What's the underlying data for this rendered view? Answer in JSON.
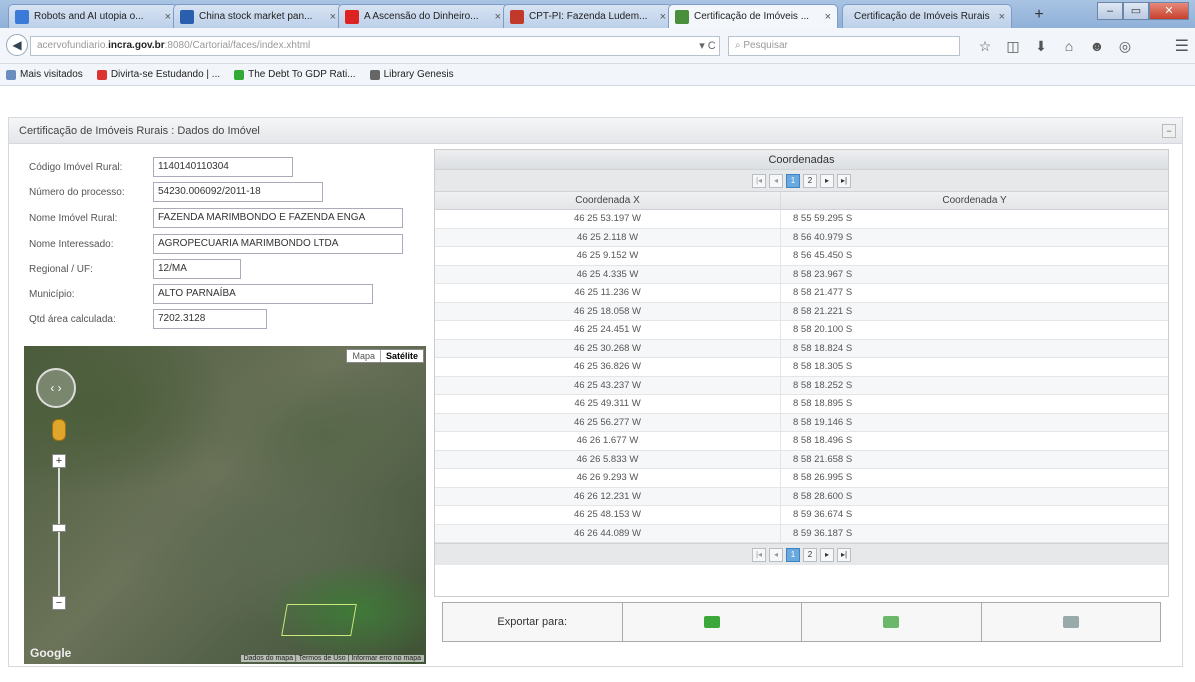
{
  "browser": {
    "tabs": [
      {
        "label": "Robots and AI utopia o...",
        "close": "×",
        "icon_color": "#3b7bd8"
      },
      {
        "label": "China stock market pan...",
        "close": "×",
        "icon_color": "#2a5fb0"
      },
      {
        "label": "A Ascensão do Dinheiro...",
        "close": "×",
        "icon_color": "#d22"
      },
      {
        "label": "CPT-PI: Fazenda Ludem...",
        "close": "×",
        "icon_color": "#c0392b"
      },
      {
        "label": "Certificação de Imóveis ...",
        "close": "×",
        "icon_color": "#4a8f3c"
      },
      {
        "label": "Certificação de Imóveis Rurais",
        "close": "×",
        "icon_color": ""
      }
    ],
    "new_tab": "+",
    "url_prefix": "acervofundiario.",
    "url_domain": "incra.gov.br",
    "url_suffix": ":8080/Cartorial/faces/index.xhtml",
    "reload": "▾ C",
    "search_placeholder": "Pesquisar",
    "tools": [
      "☆",
      "◫",
      "⬇",
      "⌂",
      "☻",
      "◎"
    ],
    "menu_icon": "☰",
    "bookmarks": [
      {
        "label": "Mais visitados",
        "color": "#6a8fbf"
      },
      {
        "label": "Divirta-se Estudando | ...",
        "color": "#d33"
      },
      {
        "label": "The Debt To GDP Rati...",
        "color": "#3a3"
      },
      {
        "label": "Library Genesis",
        "color": "#666"
      }
    ]
  },
  "panel": {
    "title": "Certificação de Imóveis Rurais : Dados do Imóvel",
    "collapse": "−"
  },
  "fields": [
    {
      "label": "Código Imóvel Rural:",
      "value": "1140140110304"
    },
    {
      "label": "Número do processo:",
      "value": "54230.006092/2011-18"
    },
    {
      "label": "Nome Imóvel Rural:",
      "value": "FAZENDA MARIMBONDO E FAZENDA ENGA"
    },
    {
      "label": "Nome Interessado:",
      "value": "AGROPECUARIA MARIMBONDO LTDA"
    },
    {
      "label": "Regional / UF:",
      "value": "12/MA"
    },
    {
      "label": "Município:",
      "value": "ALTO PARNAÍBA"
    },
    {
      "label": "Qtd área calculada:",
      "value": "7202.3128"
    }
  ],
  "map": {
    "types": [
      "Mapa",
      "Satélite"
    ],
    "zoom_in": "+",
    "zoom_out": "−",
    "logo": "Google",
    "attribution": "Dados do mapa | Termos de Uso | Informar erro no mapa"
  },
  "coords": {
    "title": "Coordenadas",
    "pager": {
      "first": "|◂",
      "prev": "◂",
      "page1": "1",
      "page2": "2",
      "next": "▸",
      "last": "▸|"
    },
    "header_x": "Coordenada X",
    "header_y": "Coordenada Y",
    "rows": [
      [
        "46 25 53.197 W",
        "8 55 59.295 S"
      ],
      [
        "46 25 2.118 W",
        "8 56 40.979 S"
      ],
      [
        "46 25 9.152 W",
        "8 56 45.450 S"
      ],
      [
        "46 25 4.335 W",
        "8 58 23.967 S"
      ],
      [
        "46 25 11.236 W",
        "8 58 21.477 S"
      ],
      [
        "46 25 18.058 W",
        "8 58 21.221 S"
      ],
      [
        "46 25 24.451 W",
        "8 58 20.100 S"
      ],
      [
        "46 25 30.268 W",
        "8 58 18.824 S"
      ],
      [
        "46 25 36.826 W",
        "8 58 18.305 S"
      ],
      [
        "46 25 43.237 W",
        "8 58 18.252 S"
      ],
      [
        "46 25 49.311 W",
        "8 58 18.895 S"
      ],
      [
        "46 25 56.277 W",
        "8 58 19.146 S"
      ],
      [
        "46 26 1.677 W",
        "8 58 18.496 S"
      ],
      [
        "46 26 5.833 W",
        "8 58 21.658 S"
      ],
      [
        "46 26 9.293 W",
        "8 58 26.995 S"
      ],
      [
        "46 26 12.231 W",
        "8 58 28.600 S"
      ],
      [
        "46 25 48.153 W",
        "8 59 36.674 S"
      ],
      [
        "46 26 44.089 W",
        "8 59 36.187 S"
      ]
    ]
  },
  "export": {
    "label": "Exportar para:",
    "options": [
      {
        "icon": "kml-icon",
        "color": "#3aa83a"
      },
      {
        "icon": "shapefile-icon",
        "color": "#6bb86b"
      },
      {
        "icon": "pdf-icon",
        "color": "#9aa"
      }
    ]
  }
}
